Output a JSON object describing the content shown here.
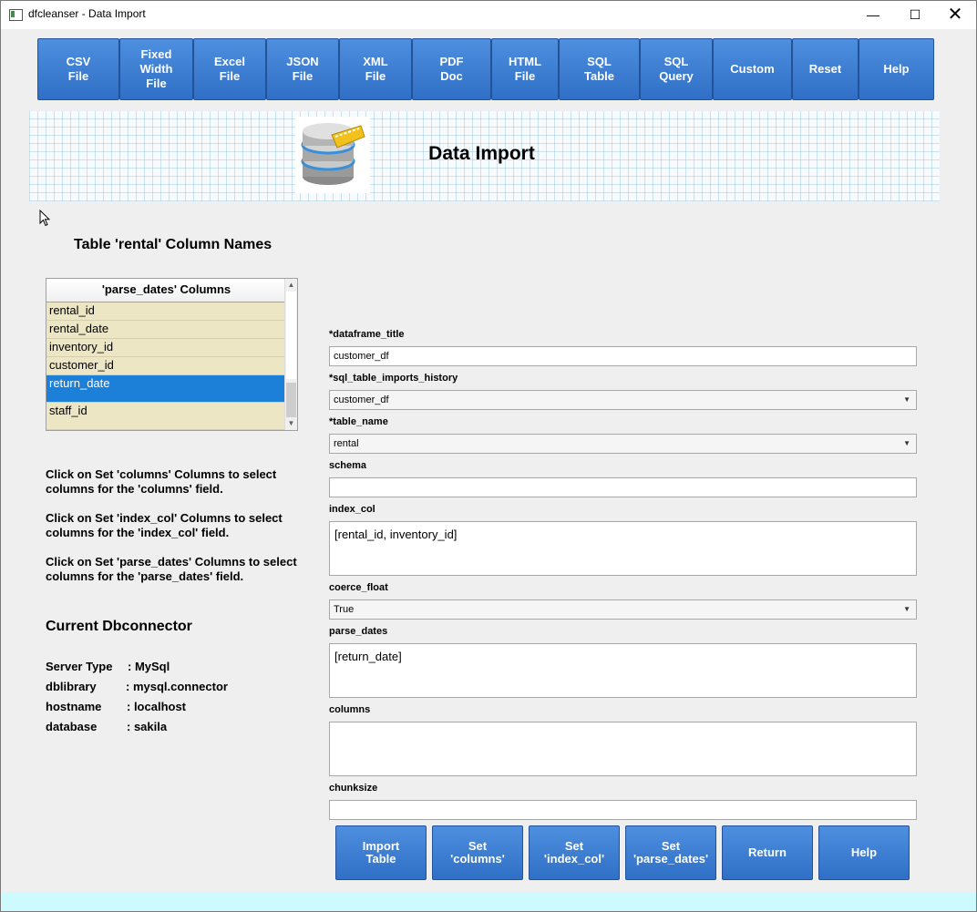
{
  "window": {
    "title": "dfcleanser - Data Import",
    "minimize_glyph": "—",
    "maximize_glyph": "☐",
    "close_glyph": "✕"
  },
  "nav": {
    "buttons": [
      {
        "label": "CSV\nFile"
      },
      {
        "label": "Fixed\nWidth\nFile"
      },
      {
        "label": "Excel\nFile"
      },
      {
        "label": "JSON\nFile"
      },
      {
        "label": "XML\nFile"
      },
      {
        "label": "PDF\nDoc"
      },
      {
        "label": "HTML\nFile"
      },
      {
        "label": "SQL\nTable"
      },
      {
        "label": "SQL\nQuery"
      },
      {
        "label": "Custom"
      },
      {
        "label": "Reset"
      },
      {
        "label": "Help"
      }
    ]
  },
  "banner": {
    "title": "Data Import",
    "icon": "database-import-icon"
  },
  "columns_panel": {
    "heading": "Table 'rental' Column Names",
    "list_header": "'parse_dates' Columns",
    "items": [
      {
        "label": "rental_id",
        "selected": false
      },
      {
        "label": "rental_date",
        "selected": false
      },
      {
        "label": "inventory_id",
        "selected": false
      },
      {
        "label": "customer_id",
        "selected": false
      },
      {
        "label": "return_date",
        "selected": true
      },
      {
        "label": "staff_id",
        "selected": false
      }
    ]
  },
  "help_text": {
    "columns": "Click on Set 'columns' Columns to select columns for the 'columns' field.",
    "index_col": "Click on Set 'index_col' Columns to select columns for the 'index_col' field.",
    "parse_dates": "Click on Set 'parse_dates' Columns to select columns for the 'parse_dates' field."
  },
  "dbconnector": {
    "title": "Current Dbconnector",
    "rows": [
      {
        "key": "Server Type",
        "value": ": MySql"
      },
      {
        "key": "dblibrary",
        "value": ": mysql.connector"
      },
      {
        "key": "hostname",
        "value": ": localhost"
      },
      {
        "key": "database",
        "value": ": sakila"
      }
    ]
  },
  "form": {
    "dataframe_title": {
      "label": "*dataframe_title",
      "value": "customer_df"
    },
    "sql_table_imports_history": {
      "label": "*sql_table_imports_history",
      "value": "customer_df"
    },
    "table_name": {
      "label": "*table_name",
      "value": "rental"
    },
    "schema": {
      "label": "schema",
      "value": ""
    },
    "index_col": {
      "label": "index_col",
      "value": "[rental_id, inventory_id]"
    },
    "coerce_float": {
      "label": "coerce_float",
      "value": "True"
    },
    "parse_dates": {
      "label": "parse_dates",
      "value": "[return_date]"
    },
    "columns": {
      "label": "columns",
      "value": ""
    },
    "chunksize": {
      "label": "chunksize",
      "value": ""
    }
  },
  "actions": {
    "import_table": "Import\nTable",
    "set_columns": "Set\n'columns'",
    "set_index_col": "Set\n'index_col'",
    "set_parse_dates": "Set\n'parse_dates'",
    "return": "Return",
    "help": "Help"
  },
  "colors": {
    "button_blue": "#3a7bd5",
    "selected_row": "#1c7fd8",
    "list_row_bg": "#ede6c5",
    "bottom_strip": "#ccfaff"
  }
}
